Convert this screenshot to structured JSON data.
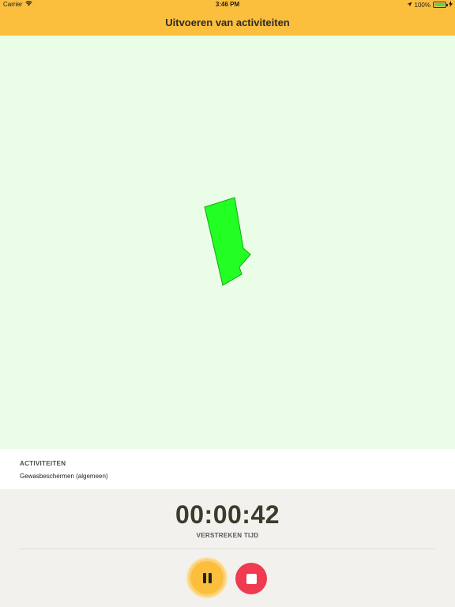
{
  "status_bar": {
    "carrier": "Carrier",
    "time": "3:46 PM",
    "battery_percent": "100%",
    "battery_level": 1.0,
    "wifi_icon": "wifi-icon",
    "location_icon": "location-arrow-icon",
    "charging_icon": "charging-bolt-icon"
  },
  "navbar": {
    "title": "Uitvoeren van activiteiten"
  },
  "map": {
    "background_color": "#e9fde7",
    "field_fill_color": "#22ff22",
    "field_stroke_color": "#1aa31a"
  },
  "activities": {
    "heading": "ACTIVITEITEN",
    "value": "Gewasbeschermen (algemeen)"
  },
  "timer": {
    "elapsed": "00:00:42",
    "label": "VERSTREKEN TIJD"
  },
  "controls": {
    "pause_icon": "pause-icon",
    "stop_icon": "stop-icon",
    "pause_color": "#fcbf3d",
    "stop_color": "#ef3a4f"
  },
  "colors": {
    "accent": "#fcbf3d",
    "panel_background": "#f2f1ed"
  }
}
